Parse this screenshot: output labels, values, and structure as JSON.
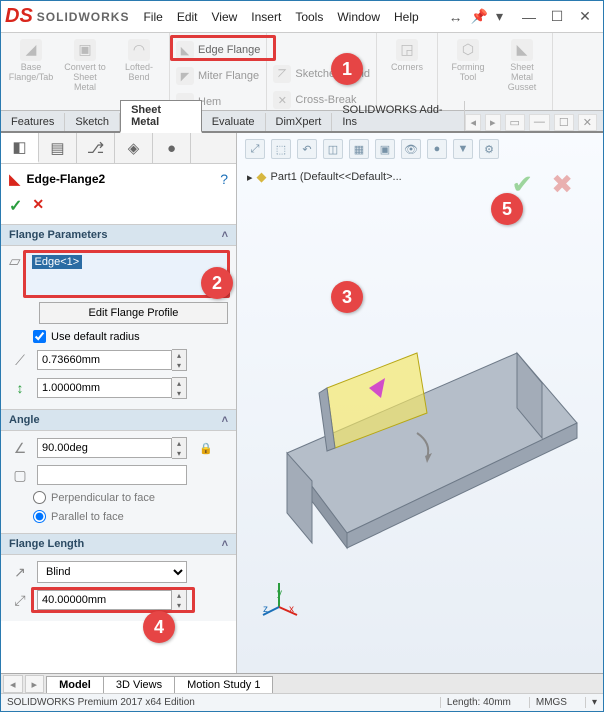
{
  "app": {
    "logo": "DS",
    "name": "SOLIDWORKS"
  },
  "menu": [
    "File",
    "Edit",
    "View",
    "Insert",
    "Tools",
    "Window",
    "Help"
  ],
  "ribbon": {
    "big": [
      {
        "label": "Base Flange/Tab"
      },
      {
        "label": "Convert to Sheet Metal"
      },
      {
        "label": "Lofted-Bend"
      }
    ],
    "col1": [
      {
        "label": "Edge Flange"
      },
      {
        "label": "Miter Flange"
      },
      {
        "label": "Hem"
      }
    ],
    "col2": [
      {
        "label": "Sketched Bend"
      },
      {
        "label": "Cross-Break"
      }
    ],
    "corners": "Corners",
    "big2": [
      {
        "label": "Forming Tool"
      },
      {
        "label": "Sheet Metal Gusset"
      }
    ]
  },
  "tabs": [
    "Features",
    "Sketch",
    "Sheet Metal",
    "Evaluate",
    "DimXpert",
    "SOLIDWORKS Add-Ins"
  ],
  "active_tab": "Sheet Metal",
  "feature": {
    "name": "Edge-Flange2",
    "ok_icon": "✓",
    "cancel_icon": "✕",
    "help_icon": "?"
  },
  "flange_params": {
    "title": "Flange Parameters",
    "edge": "Edge<1>",
    "edit_btn": "Edit Flange Profile",
    "use_default": "Use default radius",
    "radius": "0.73660mm",
    "offset": "1.00000mm"
  },
  "angle": {
    "title": "Angle",
    "value": "90.00deg",
    "blank": "",
    "perp": "Perpendicular to face",
    "para": "Parallel to face"
  },
  "length": {
    "title": "Flange Length",
    "type": "Blind",
    "value": "40.00000mm"
  },
  "tree": {
    "part": "Part1  (Default<<Default>..."
  },
  "btabs": [
    "Model",
    "3D Views",
    "Motion Study 1"
  ],
  "status": {
    "product": "SOLIDWORKS Premium 2017 x64 Edition",
    "length": "Length: 40mm",
    "units": "MMGS"
  },
  "triad": {
    "x": "x",
    "y": "y",
    "z": "z"
  },
  "callouts": {
    "c1": "1",
    "c2": "2",
    "c3": "3",
    "c4": "4",
    "c5": "5"
  },
  "chart_data": null
}
